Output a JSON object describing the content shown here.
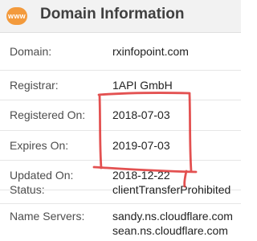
{
  "header": {
    "icon_label": "www",
    "title": "Domain Information"
  },
  "rows": [
    {
      "label": "Domain:",
      "value": "rxinfopoint.com"
    },
    {
      "label": "Registrar:",
      "value": "1API GmbH"
    },
    {
      "label": "Registered On:",
      "value": "2018-07-03"
    },
    {
      "label": "Expires On:",
      "value": "2019-07-03"
    },
    {
      "label": "Updated On:",
      "value": "2018-12-22"
    },
    {
      "label": "Status:",
      "value": "clientTransferProhibited"
    },
    {
      "label": "Name Servers:",
      "values": [
        "sandy.ns.cloudflare.com",
        "sean.ns.cloudflare.com"
      ]
    }
  ],
  "colors": {
    "accent": "#f39a3c",
    "annotation": "#e03a3a"
  }
}
